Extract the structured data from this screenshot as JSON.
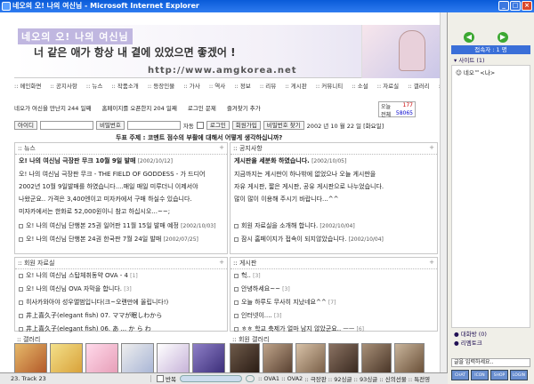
{
  "window": {
    "title": "네오의 오! 나의 여신님 - Microsoft Internet Explorer"
  },
  "banner": {
    "title": "네오의 오! 나의 여신님",
    "slogan": "너 같은 애가 항상 내 곁에 있었으면 좋겠어 !",
    "url": "http://www.amgkorea.net"
  },
  "topnav": [
    "메인화면",
    "공지사항",
    "뉴스",
    "작품소개",
    "등장인물",
    "가사",
    "역사",
    "정보",
    "리뷰",
    "게시판",
    "커뮤니티",
    "소설",
    "자료실",
    "갤러리",
    "기타"
  ],
  "info": {
    "days_goddess": "네오가 여신을 만난지 244 일째",
    "days_homepage": "홈페이지를 오픈한지 204 일째",
    "login_issue": "로그인 문제",
    "favorites": "즐겨찾기 추가",
    "counter_today_label": "오늘",
    "counter_today": "177",
    "counter_total_label": "전체",
    "counter_total": "58065"
  },
  "login": {
    "id_label": "아이디",
    "pw_label": "비밀번호",
    "auto": "자동",
    "login_btn": "로그인",
    "join_btn": "회원가입",
    "find_btn": "비밀번호 찾기",
    "date": "2002 년 10 월 22 일 [화요일]"
  },
  "topic": "두표 주제 : 코멘트 점수의 부활에 대해서 어떻게 생각하십니까?",
  "news": {
    "header": "뉴스",
    "headline": "오! 나의 여신님 극장판 무크 10월 9일 발매",
    "headline_date": "[2002/10/12]",
    "body": [
      "오! 나의 여신님 극장판 무크 - THE FIELD OF GODDESS - 가 드디어",
      "2002년 10월 9일발매를 하였습니다....매일 매일 미루더니 이제서야",
      "나왔군요.. 가격은 3,400엔이고 미자카에서 구매 하실수 있습니다.",
      "미자카에서는 한화로 52,000원이니 참고 하십시오...~~;"
    ],
    "items": [
      {
        "text": "오! 나의 여신님 단행본 25권 일어판 11월 15일 발매 예정",
        "date": "[2002/10/03]"
      },
      {
        "text": "오! 나의 여신님 단행본 24권 한국판 7월 24일 발매",
        "date": "[2002/07/25]"
      }
    ]
  },
  "notice": {
    "header": "공지사항",
    "headline": "게시판을 세분화 하였습니다.",
    "headline_date": "[2002/10/05]",
    "body": [
      "지금까지는 게시판이 하나밖에 없었으나 오늘 게시판을",
      "자유 게시판, 짧은 게시판, 공유 게시판으로 나누었습니다.",
      "많이 많이 이용해 주시기 바랍니다...^^"
    ],
    "items": [
      {
        "text": "회원 자료실을 소개해 합니다.",
        "date": "[2002/10/04]"
      },
      {
        "text": "잠시 홈페이지가 접속이 되지않았습니다.",
        "date": "[2002/10/04]"
      }
    ]
  },
  "members": {
    "header": "회원 자료실",
    "items": [
      {
        "text": "오! 나의 여신님 스탑체취동약 OVA - 4",
        "count": "[1]"
      },
      {
        "text": "오! 나의 여신님 OVA 자막을 합니다.",
        "count": "[3]"
      },
      {
        "text": "히사카와아야 성우앨범입니다(크~오랜만에 올립니다!)",
        "count": ""
      },
      {
        "text": "井上喜久子(elegant fish) 07. ママが眠しわから",
        "count": ""
      },
      {
        "text": "井上喜久子(elegant fish) 06. あ ... か ら わ",
        "count": ""
      }
    ]
  },
  "board": {
    "header": "게시판",
    "items": [
      {
        "text": "헉..",
        "count": "[3]"
      },
      {
        "text": "안녕하세요~~",
        "count": "[3]"
      },
      {
        "text": "오늘 하루도 무사히 지났네요^^",
        "count": "[7]"
      },
      {
        "text": "인터넷이....",
        "count": "[3]"
      },
      {
        "text": "ㅎㅎ 학교 축제가 얼마 남지 않았군요.. ㅡㅡ",
        "count": "[6]"
      }
    ]
  },
  "gallery": {
    "header": "갤러리"
  },
  "member_gallery": {
    "header": "회원 갤러리"
  },
  "status": {
    "track": "23. Track 23",
    "repeat": "반복",
    "links": [
      "OVA1",
      "OVA2",
      "극장판",
      "92싱글",
      "93싱글",
      "신의선물",
      "특전영"
    ]
  },
  "sidebar": {
    "online": "접속자 : 1 명",
    "sites_label": "사이트 (1)",
    "user": "네오™<나>",
    "chat_label": "대화방 (0)",
    "remote_label": "리멤토크",
    "chat_placeholder": "글을 입력하세요..",
    "tools": [
      "CHAT",
      "ICON",
      "SHOP",
      "LOGIN"
    ]
  },
  "colors": {
    "titlebar": "#0a5bd8",
    "accent": "#3a6fd8",
    "highlight": "#c00000"
  }
}
